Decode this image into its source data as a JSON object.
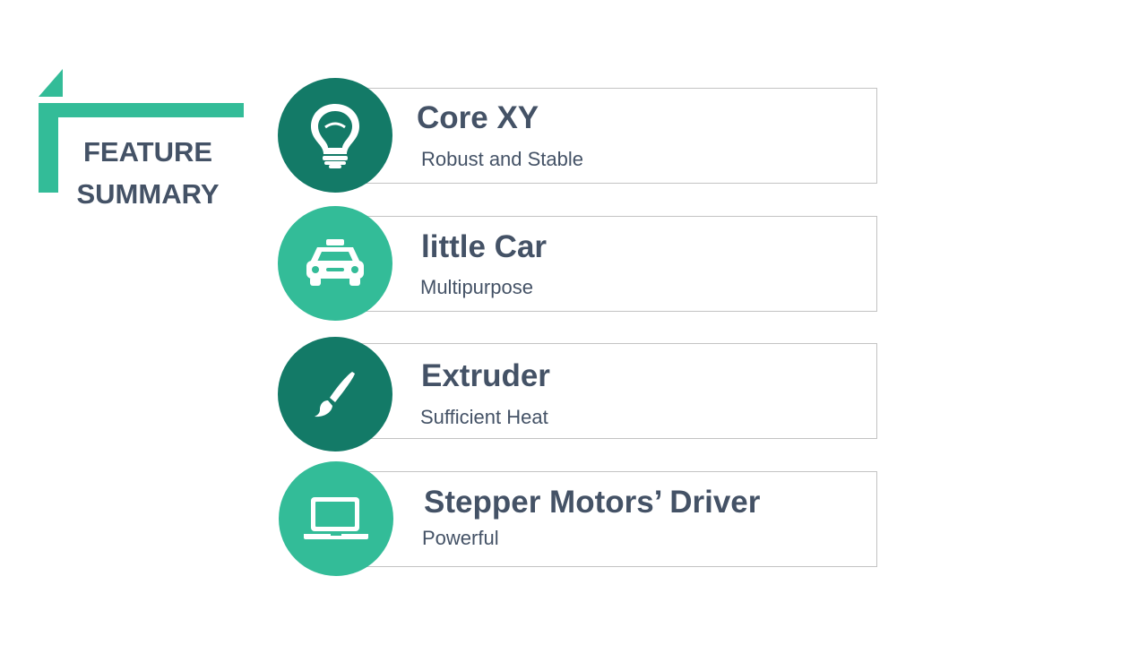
{
  "heading": {
    "line1": "FEATURE",
    "line2": "SUMMARY"
  },
  "colors": {
    "accent": "#33bc98",
    "dark_accent": "#137a67",
    "text": "#445266",
    "border": "#c3c3c3"
  },
  "features": [
    {
      "title": "Core XY",
      "subtitle": "Robust and Stable",
      "icon": "lightbulb-icon",
      "circle": "dark"
    },
    {
      "title": "little Car",
      "subtitle": "Multipurpose",
      "icon": "taxi-icon",
      "circle": "light"
    },
    {
      "title": "Extruder",
      "subtitle": "Sufficient Heat",
      "icon": "paintbrush-icon",
      "circle": "dark"
    },
    {
      "title": "Stepper Motors’ Driver",
      "subtitle": "Powerful",
      "icon": "laptop-icon",
      "circle": "light"
    }
  ]
}
